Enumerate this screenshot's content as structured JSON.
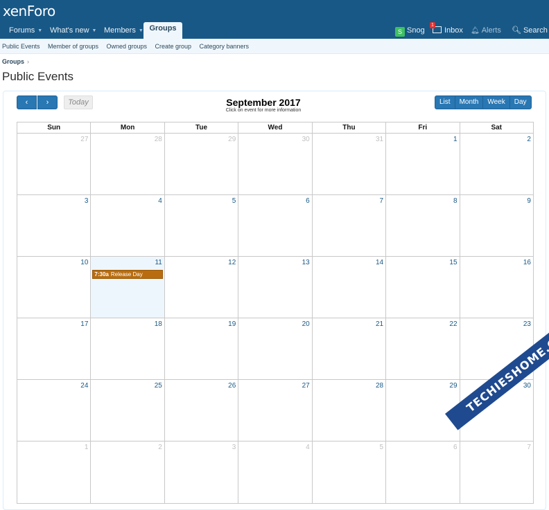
{
  "header": {
    "logo": "xenForo",
    "nav": [
      {
        "label": "Forums",
        "caret": true
      },
      {
        "label": "What's new",
        "caret": true
      },
      {
        "label": "Members",
        "caret": true
      },
      {
        "label": "Groups",
        "selected": true
      }
    ],
    "user": {
      "avatar_letter": "S",
      "name": "Snog",
      "inbox_label": "Inbox",
      "inbox_count": "1",
      "alerts_label": "Alerts",
      "search_label": "Search"
    }
  },
  "subnav": [
    "Public Events",
    "Member of groups",
    "Owned groups",
    "Create group",
    "Category banners"
  ],
  "breadcrumb": "Groups",
  "page_title": "Public Events",
  "calendar": {
    "prev_label": "‹",
    "next_label": "›",
    "today_label": "Today",
    "views": [
      "List",
      "Month",
      "Week",
      "Day"
    ],
    "title": "September 2017",
    "subtitle": "Click on event for more information",
    "weekdays": [
      "Sun",
      "Mon",
      "Tue",
      "Wed",
      "Thu",
      "Fri",
      "Sat"
    ],
    "weeks": [
      [
        {
          "n": "27",
          "o": true
        },
        {
          "n": "28",
          "o": true
        },
        {
          "n": "29",
          "o": true
        },
        {
          "n": "30",
          "o": true
        },
        {
          "n": "31",
          "o": true
        },
        {
          "n": "1"
        },
        {
          "n": "2"
        }
      ],
      [
        {
          "n": "3"
        },
        {
          "n": "4"
        },
        {
          "n": "5"
        },
        {
          "n": "6"
        },
        {
          "n": "7"
        },
        {
          "n": "8"
        },
        {
          "n": "9"
        }
      ],
      [
        {
          "n": "10"
        },
        {
          "n": "11",
          "today": true,
          "event": {
            "time": "7:30a",
            "title": "Release Day"
          }
        },
        {
          "n": "12"
        },
        {
          "n": "13"
        },
        {
          "n": "14"
        },
        {
          "n": "15"
        },
        {
          "n": "16"
        }
      ],
      [
        {
          "n": "17"
        },
        {
          "n": "18"
        },
        {
          "n": "19"
        },
        {
          "n": "20"
        },
        {
          "n": "21"
        },
        {
          "n": "22"
        },
        {
          "n": "23"
        }
      ],
      [
        {
          "n": "24"
        },
        {
          "n": "25"
        },
        {
          "n": "26"
        },
        {
          "n": "27"
        },
        {
          "n": "28"
        },
        {
          "n": "29"
        },
        {
          "n": "30"
        }
      ],
      [
        {
          "n": "1",
          "o": true
        },
        {
          "n": "2",
          "o": true
        },
        {
          "n": "3",
          "o": true
        },
        {
          "n": "4",
          "o": true
        },
        {
          "n": "5",
          "o": true
        },
        {
          "n": "6",
          "o": true
        },
        {
          "n": "7",
          "o": true
        }
      ]
    ]
  },
  "watermark": "TECHIESHOME.COM",
  "colors": {
    "header": "#185886",
    "accent": "#2977b3",
    "event": "#b96d10"
  }
}
